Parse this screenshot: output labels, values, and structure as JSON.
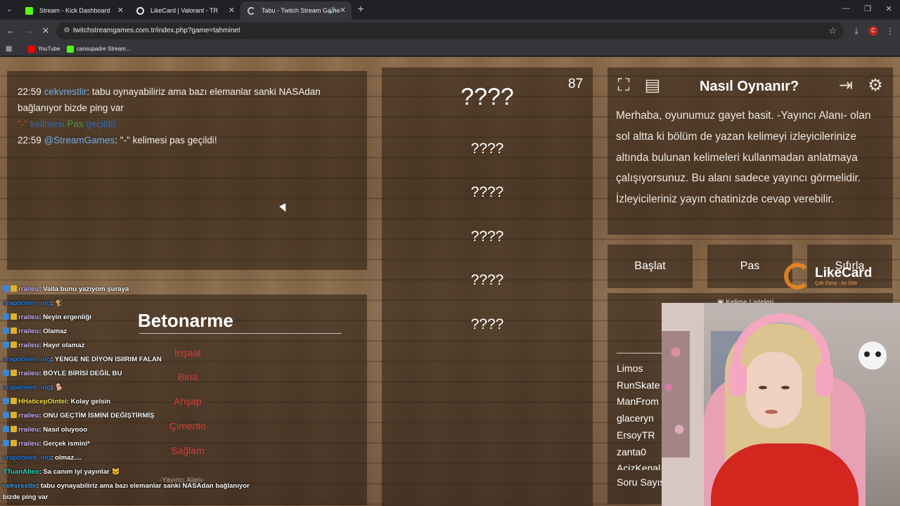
{
  "browser": {
    "tabs": [
      {
        "title": "Stream - Kick Dashboard",
        "color": "#53fc18"
      },
      {
        "title": "LikeCard | Valorant - TR",
        "color": "#e8eaed"
      },
      {
        "title": "Tabu - Twitch Stream Game",
        "color": "#bdc1c6",
        "active": true
      }
    ],
    "url": "twitchstreamgames.com.tr/index.php?game=tahminet",
    "bookmarks": [
      {
        "label": "YouTube",
        "color": "#ff0000"
      },
      {
        "label": "cansupadre Stream...",
        "color": "#53fc18"
      }
    ],
    "profile_initial": "C"
  },
  "chat": {
    "lines": [
      {
        "time": "22:59",
        "user": "cekvrestlir",
        "text": ": tabu oynayabiliriz ama bazı elemanlar sanki NASAdan bağlanıyor bizde ping var"
      },
      {
        "q": "\"-\"",
        "mid": " kelimesi ",
        "pas": "Pas",
        "end": " geçildi!"
      },
      {
        "time": "22:59",
        "user": "@StreamGames",
        "text": ": \"-\" kelimesi pas geçildi!"
      }
    ]
  },
  "card": {
    "word": "Betonarme",
    "taboo_words": [
      "İnşaat",
      "Bina",
      "Ahşap",
      "Çimento",
      "Sağlam"
    ],
    "area_label": "-Yayıncı Alanı-"
  },
  "overlay_chat": [
    {
      "user": "rraileu",
      "color": "purple",
      "text": ": Valla bunu yazıyom şuraya"
    },
    {
      "user": "arapdoven_ing",
      "color": "blue",
      "text": ": 🐒"
    },
    {
      "user": "rraileu",
      "color": "purple",
      "text": ": Neyin ergenliği"
    },
    {
      "user": "rraileu",
      "color": "purple",
      "text": ": Olamaz"
    },
    {
      "user": "rraileu",
      "color": "purple",
      "text": ": Hayır olamaz"
    },
    {
      "user": "arapdoven_ing",
      "color": "blue",
      "text": ": YENGE NE DİYON ISIIRIM FALAN"
    },
    {
      "user": "rraileu",
      "color": "purple",
      "text": ": BÖYLE BİRİSİ DEĞİL BU"
    },
    {
      "user": "arapdoven_ing",
      "color": "blue",
      "text": ": 🐕"
    },
    {
      "user": "HHaticepOintei",
      "color": "yellow",
      "text": ": Kolay gelsin"
    },
    {
      "user": "rraileu",
      "color": "purple",
      "text": ": ONU GEÇTİM İSMİNİ DEĞİŞTİRMİŞ"
    },
    {
      "user": "rraileu",
      "color": "purple",
      "text": ": Nasıl oluyooo"
    },
    {
      "user": "rraileu",
      "color": "purple",
      "text": ": Gerçek ismini*"
    },
    {
      "user": "arapdoven_ing",
      "color": "blue",
      "text": ": olmaz...."
    },
    {
      "user": "TTuanAbee",
      "color": "teal",
      "text": ": Sa canım iyi yayınlar 🐱"
    },
    {
      "user": "cekvrestlir",
      "color": "cyan",
      "text": ": tabu oynayabiliriz ama bazı elemanlar sanki NASAdan bağlanıyor"
    },
    {
      "user": "",
      "color": "cyan",
      "text": "bizde ping var"
    }
  ],
  "middle": {
    "count": "87",
    "hidden": [
      "????",
      "????",
      "????",
      "????",
      "????",
      "????"
    ]
  },
  "howto": {
    "title": "Nasıl Oynanır?",
    "text": "Merhaba, oyunumuz gayet basit. -Yayıncı Alanı- olan sol altta ki bölüm de yazan kelimeyi izleyicilerinize altında bulunan kelimeleri kullanmadan anlatmaya çalışıyorsunuz. Bu alanı sadece yayıncı görmelidir. İzleyicileriniz yayın chatinizde cevap verebilir."
  },
  "buttons": {
    "start": "Başlat",
    "pass": "Pas",
    "reset": "Sıfırla"
  },
  "lists": {
    "label": "Kelime Listeleri",
    "players": [
      "Limos",
      "RunSkate",
      "ManFrom",
      "glaceryn",
      "ErsoyTR",
      "zanta0",
      "AcizKenal",
      "Soru Sayısı"
    ]
  },
  "logo": {
    "name": "LikeCard",
    "tagline": "Çok Oyna · Az Öde"
  }
}
